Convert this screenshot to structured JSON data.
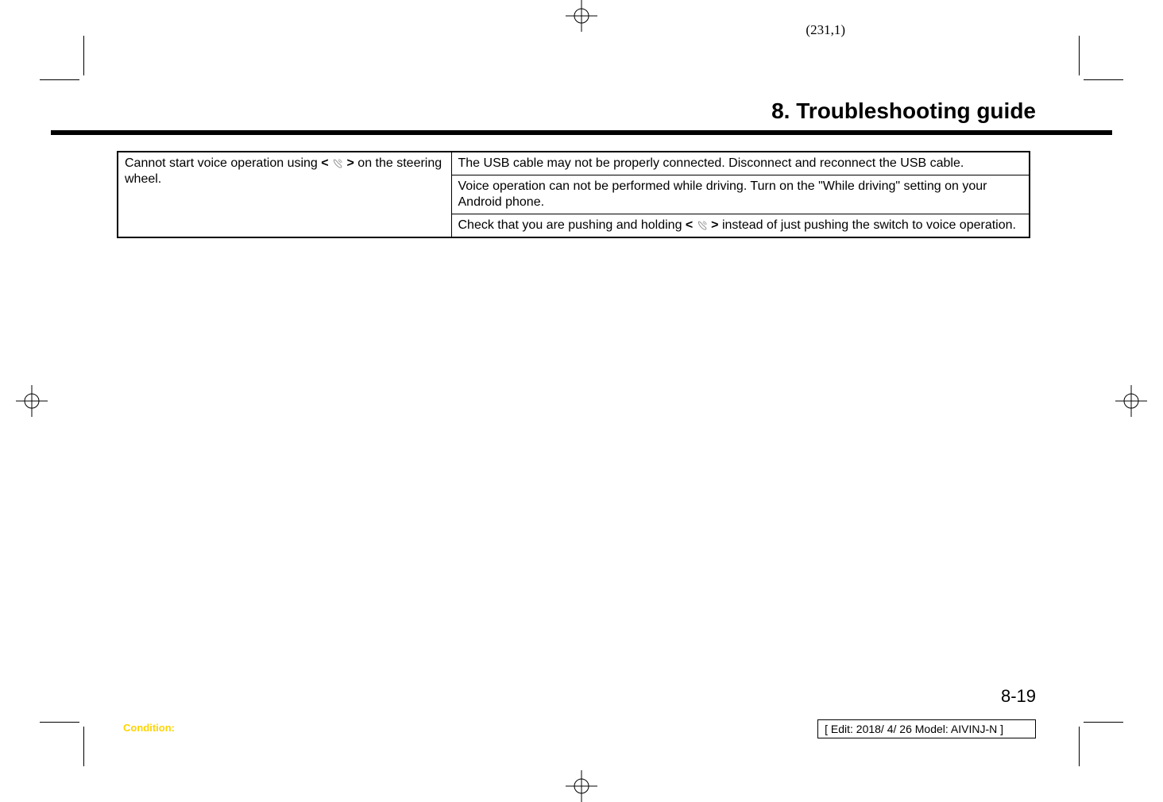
{
  "page_coord": "(231,1)",
  "chapter_title": "8. Troubleshooting guide",
  "table": {
    "left_cell": {
      "prefix": "Cannot start voice operation using ",
      "bracket_open": "<",
      "bracket_close": ">",
      "suffix": " on the steering wheel."
    },
    "rows": [
      "The USB cable may not be properly connected. Disconnect and reconnect the USB cable.",
      "Voice operation can not be performed while driving. Turn on the \"While driving\" setting on your Android phone."
    ],
    "row3": {
      "prefix": "Check that you are pushing and holding ",
      "bracket_open": "<",
      "bracket_close": ">",
      "suffix": " instead of just pushing the switch to voice operation."
    }
  },
  "page_number": "8-19",
  "condition_label": "Condition:",
  "edit_info": "[ Edit: 2018/ 4/ 26   Model: AIVINJ-N ]"
}
